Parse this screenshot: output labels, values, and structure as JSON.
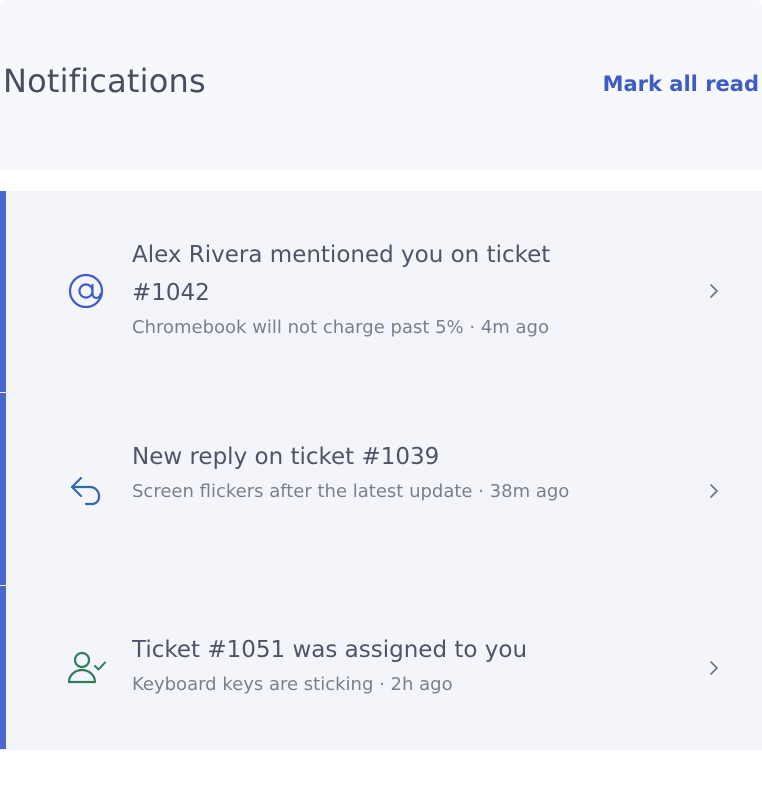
{
  "header": {
    "title": "Notifications",
    "mark_all_label": "Mark all read"
  },
  "notifications": [
    {
      "icon": "at-mention-icon",
      "headline": "Alex Rivera mentioned you on ticket #1042",
      "meta": "Chromebook will not charge past 5% · 4m ago"
    },
    {
      "icon": "reply-icon",
      "headline": "New reply on ticket #1039",
      "meta": "Screen flickers after the latest update · 38m ago"
    },
    {
      "icon": "user-assigned-icon",
      "headline": "Ticket #1051 was assigned to you",
      "meta": "Keyboard keys are sticking · 2h ago"
    }
  ],
  "colors": {
    "accent": "#3e5bc6",
    "mention_icon": "#3e5bc6",
    "reply_icon": "#2f6aa6",
    "assigned_icon": "#2e7d5b"
  }
}
